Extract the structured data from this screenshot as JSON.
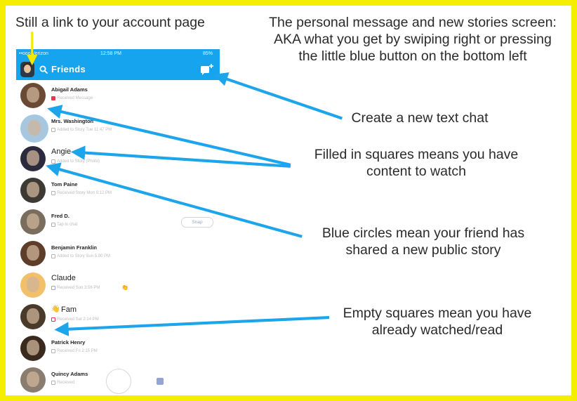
{
  "annotations": {
    "account_link": "Still a link to your account page",
    "header_line1": "The personal message and new stories screen:",
    "header_line2": "AKA what you get by swiping right or pressing",
    "header_line3": "the little blue button on the bottom left",
    "new_chat": "Create a new text chat",
    "filled_line1": "Filled in squares means you have",
    "filled_line2": "content to watch",
    "blue_line1": "Blue circles mean your friend has",
    "blue_line2": "shared a new public story",
    "empty_line1": "Empty squares mean you have",
    "empty_line2": "already watched/read"
  },
  "phone": {
    "statusbar": {
      "carrier": "••ooo Verizon",
      "time": "12:58 PM",
      "battery": "85%"
    },
    "navbar": {
      "title": "Friends"
    },
    "friends": [
      {
        "name": "Abigail Adams",
        "sub": "Received Message",
        "indicator_color": "#e8364f",
        "indicator_filled": true
      },
      {
        "name": "Mrs. Washington",
        "sub": "Added to Story  Tue 11:47 PM",
        "indicator_color": "#b2b2b2",
        "indicator_filled": false
      },
      {
        "name": "Angie",
        "sub": "Added to Story  (Photo)",
        "indicator_color": "#b2b2b2",
        "indicator_filled": false,
        "large": true
      },
      {
        "name": "Tom Paine",
        "sub": "Received  Story  Mon 9:12 PM",
        "indicator_color": "#b2b2b2",
        "indicator_filled": false
      },
      {
        "name": "Fred D.",
        "sub": "Tap to chat",
        "indicator_color": "#b2b2b2",
        "indicator_filled": false,
        "snap_label": "Snap"
      },
      {
        "name": "Benjamin Franklin",
        "sub": "Added to Story  Sun 5:00 PM",
        "indicator_color": "#b2b2b2",
        "indicator_filled": false
      },
      {
        "name": "Claude",
        "sub": "Received  Sun 3:56 PM",
        "indicator_color": "#9aa7d4",
        "indicator_filled": false,
        "large": true,
        "emoji": "👏"
      },
      {
        "name": "Fam",
        "sub": "Received  Sat 2:14 PM",
        "indicator_color": "#e8364f",
        "indicator_filled": false,
        "large": true,
        "emoji_prefix": "👋"
      },
      {
        "name": "Patrick Henry",
        "sub": "Received  Fri 2:15 PM",
        "indicator_color": "#b2b2b2",
        "indicator_filled": false
      },
      {
        "name": "Quincy Adams",
        "sub": "Received",
        "indicator_color": "#b2b2b2",
        "indicator_filled": false
      }
    ]
  },
  "colors": {
    "frame": "#f5ee00",
    "snapchat_blue": "#16a4ee",
    "arrow_blue": "#1da5ec",
    "arrow_yellow": "#f6e800"
  },
  "icons": [
    "search-icon",
    "new-chat-icon",
    "arrow-icon"
  ]
}
